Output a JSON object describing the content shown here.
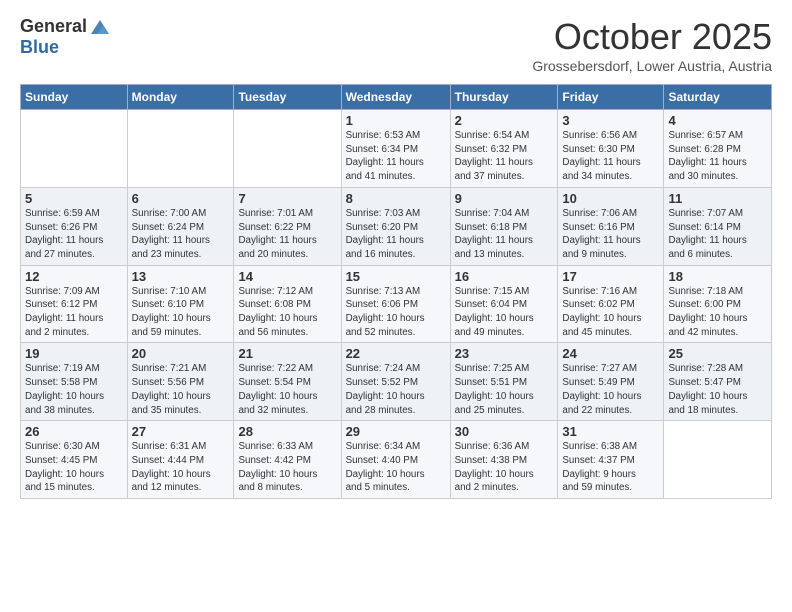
{
  "header": {
    "logo": {
      "line1": "General",
      "line2": "Blue"
    },
    "title": "October 2025",
    "subtitle": "Grossebersdorf, Lower Austria, Austria"
  },
  "weekdays": [
    "Sunday",
    "Monday",
    "Tuesday",
    "Wednesday",
    "Thursday",
    "Friday",
    "Saturday"
  ],
  "weeks": [
    [
      {
        "day": "",
        "info": ""
      },
      {
        "day": "",
        "info": ""
      },
      {
        "day": "",
        "info": ""
      },
      {
        "day": "1",
        "info": "Sunrise: 6:53 AM\nSunset: 6:34 PM\nDaylight: 11 hours\nand 41 minutes."
      },
      {
        "day": "2",
        "info": "Sunrise: 6:54 AM\nSunset: 6:32 PM\nDaylight: 11 hours\nand 37 minutes."
      },
      {
        "day": "3",
        "info": "Sunrise: 6:56 AM\nSunset: 6:30 PM\nDaylight: 11 hours\nand 34 minutes."
      },
      {
        "day": "4",
        "info": "Sunrise: 6:57 AM\nSunset: 6:28 PM\nDaylight: 11 hours\nand 30 minutes."
      }
    ],
    [
      {
        "day": "5",
        "info": "Sunrise: 6:59 AM\nSunset: 6:26 PM\nDaylight: 11 hours\nand 27 minutes."
      },
      {
        "day": "6",
        "info": "Sunrise: 7:00 AM\nSunset: 6:24 PM\nDaylight: 11 hours\nand 23 minutes."
      },
      {
        "day": "7",
        "info": "Sunrise: 7:01 AM\nSunset: 6:22 PM\nDaylight: 11 hours\nand 20 minutes."
      },
      {
        "day": "8",
        "info": "Sunrise: 7:03 AM\nSunset: 6:20 PM\nDaylight: 11 hours\nand 16 minutes."
      },
      {
        "day": "9",
        "info": "Sunrise: 7:04 AM\nSunset: 6:18 PM\nDaylight: 11 hours\nand 13 minutes."
      },
      {
        "day": "10",
        "info": "Sunrise: 7:06 AM\nSunset: 6:16 PM\nDaylight: 11 hours\nand 9 minutes."
      },
      {
        "day": "11",
        "info": "Sunrise: 7:07 AM\nSunset: 6:14 PM\nDaylight: 11 hours\nand 6 minutes."
      }
    ],
    [
      {
        "day": "12",
        "info": "Sunrise: 7:09 AM\nSunset: 6:12 PM\nDaylight: 11 hours\nand 2 minutes."
      },
      {
        "day": "13",
        "info": "Sunrise: 7:10 AM\nSunset: 6:10 PM\nDaylight: 10 hours\nand 59 minutes."
      },
      {
        "day": "14",
        "info": "Sunrise: 7:12 AM\nSunset: 6:08 PM\nDaylight: 10 hours\nand 56 minutes."
      },
      {
        "day": "15",
        "info": "Sunrise: 7:13 AM\nSunset: 6:06 PM\nDaylight: 10 hours\nand 52 minutes."
      },
      {
        "day": "16",
        "info": "Sunrise: 7:15 AM\nSunset: 6:04 PM\nDaylight: 10 hours\nand 49 minutes."
      },
      {
        "day": "17",
        "info": "Sunrise: 7:16 AM\nSunset: 6:02 PM\nDaylight: 10 hours\nand 45 minutes."
      },
      {
        "day": "18",
        "info": "Sunrise: 7:18 AM\nSunset: 6:00 PM\nDaylight: 10 hours\nand 42 minutes."
      }
    ],
    [
      {
        "day": "19",
        "info": "Sunrise: 7:19 AM\nSunset: 5:58 PM\nDaylight: 10 hours\nand 38 minutes."
      },
      {
        "day": "20",
        "info": "Sunrise: 7:21 AM\nSunset: 5:56 PM\nDaylight: 10 hours\nand 35 minutes."
      },
      {
        "day": "21",
        "info": "Sunrise: 7:22 AM\nSunset: 5:54 PM\nDaylight: 10 hours\nand 32 minutes."
      },
      {
        "day": "22",
        "info": "Sunrise: 7:24 AM\nSunset: 5:52 PM\nDaylight: 10 hours\nand 28 minutes."
      },
      {
        "day": "23",
        "info": "Sunrise: 7:25 AM\nSunset: 5:51 PM\nDaylight: 10 hours\nand 25 minutes."
      },
      {
        "day": "24",
        "info": "Sunrise: 7:27 AM\nSunset: 5:49 PM\nDaylight: 10 hours\nand 22 minutes."
      },
      {
        "day": "25",
        "info": "Sunrise: 7:28 AM\nSunset: 5:47 PM\nDaylight: 10 hours\nand 18 minutes."
      }
    ],
    [
      {
        "day": "26",
        "info": "Sunrise: 6:30 AM\nSunset: 4:45 PM\nDaylight: 10 hours\nand 15 minutes."
      },
      {
        "day": "27",
        "info": "Sunrise: 6:31 AM\nSunset: 4:44 PM\nDaylight: 10 hours\nand 12 minutes."
      },
      {
        "day": "28",
        "info": "Sunrise: 6:33 AM\nSunset: 4:42 PM\nDaylight: 10 hours\nand 8 minutes."
      },
      {
        "day": "29",
        "info": "Sunrise: 6:34 AM\nSunset: 4:40 PM\nDaylight: 10 hours\nand 5 minutes."
      },
      {
        "day": "30",
        "info": "Sunrise: 6:36 AM\nSunset: 4:38 PM\nDaylight: 10 hours\nand 2 minutes."
      },
      {
        "day": "31",
        "info": "Sunrise: 6:38 AM\nSunset: 4:37 PM\nDaylight: 9 hours\nand 59 minutes."
      },
      {
        "day": "",
        "info": ""
      }
    ]
  ]
}
